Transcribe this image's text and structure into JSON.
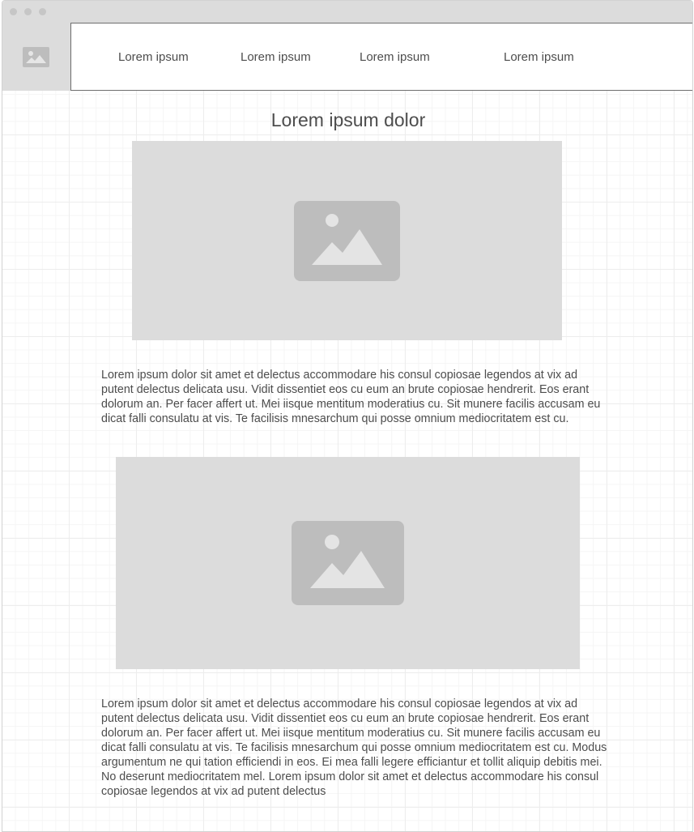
{
  "window": {
    "traffic_lights": [
      "close-dot",
      "minimize-dot",
      "maximize-dot"
    ]
  },
  "header": {
    "logo_icon": "image-icon",
    "nav": [
      {
        "label": "Lorem ipsum"
      },
      {
        "label": "Lorem ipsum"
      },
      {
        "label": "Lorem ipsum"
      },
      {
        "label": "Lorem ipsum"
      }
    ]
  },
  "main": {
    "title": "Lorem ipsum dolor",
    "image_1_icon": "image-icon",
    "paragraph_1": "Lorem ipsum dolor sit amet et delectus accommodare his consul copiosae legendos at vix ad putent delectus delicata usu. Vidit dissentiet eos cu eum an brute copiosae hendrerit. Eos erant dolorum an. Per facer affert ut. Mei iisque mentitum moderatius cu. Sit munere facilis accusam eu dicat falli consulatu at vis. Te facilisis mnesarchum qui posse omnium mediocritatem est cu.",
    "image_2_icon": "image-icon",
    "paragraph_2": "Lorem ipsum dolor sit amet et delectus accommodare his consul copiosae legendos at vix ad putent delectus delicata usu. Vidit dissentiet eos cu eum an brute copiosae hendrerit. Eos erant dolorum an. Per facer affert ut. Mei iisque mentitum moderatius cu. Sit munere facilis accusam eu dicat falli consulatu at vis. Te facilisis mnesarchum qui posse omnium mediocritatem est cu. Modus argumentum ne qui tation efficiendi in eos. Ei mea falli legere efficiantur et tollit aliquip debitis mei. No deserunt mediocritatem mel. Lorem ipsum dolor sit amet et delectus accommodare his consul copiosae legendos at vix ad putent delectus"
  },
  "colors": {
    "placeholder_fill": "#dcdcdc",
    "placeholder_icon": "#bdbdbd",
    "text": "#4d4d4d",
    "nav_border": "#6e6e6e"
  }
}
